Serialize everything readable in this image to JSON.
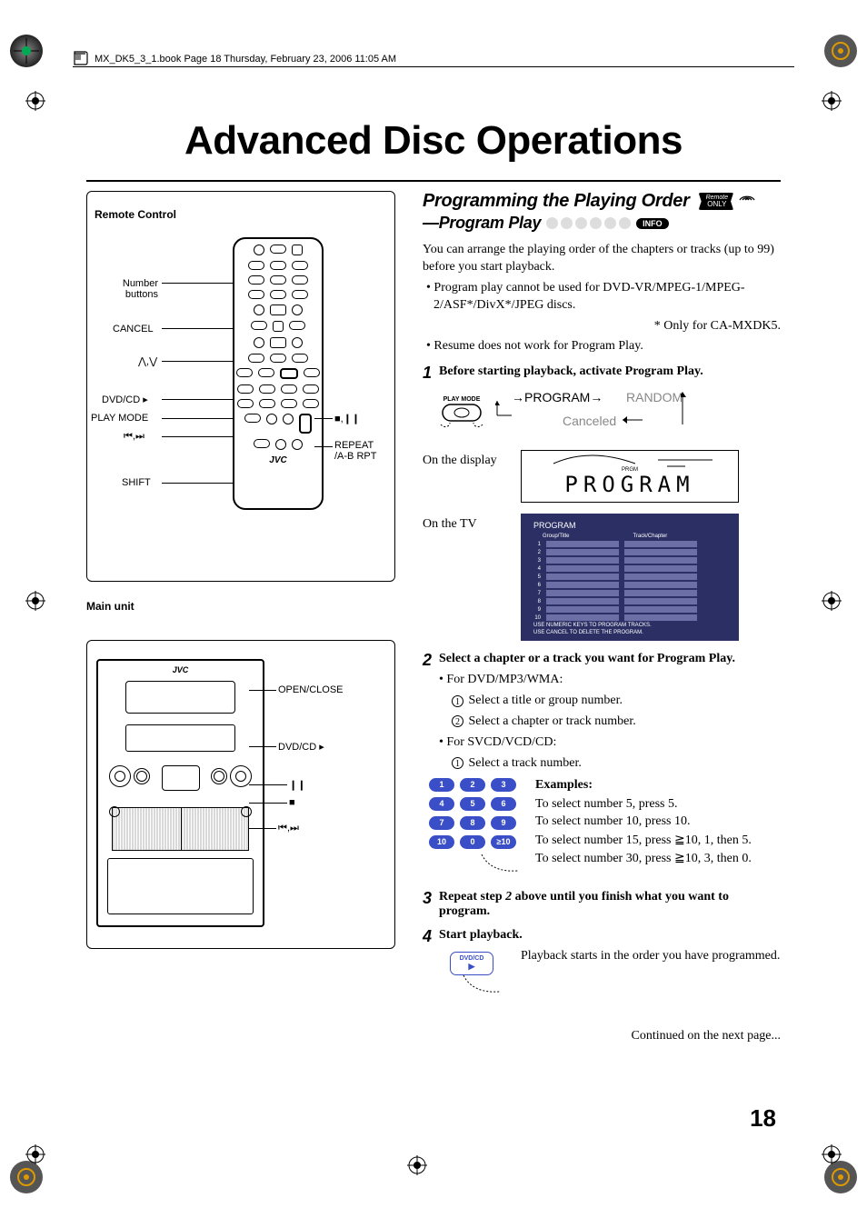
{
  "header": {
    "meta": "MX_DK5_3_1.book  Page 18  Thursday, February 23, 2006  11:05 AM"
  },
  "title": "Advanced Disc Operations",
  "left": {
    "remote_title": "Remote Control",
    "main_title": "Main unit",
    "remote_labels": {
      "number_buttons": "Number\nbuttons",
      "cancel": "CANCEL",
      "cursors": "⋀,⋁",
      "dvdcd": "DVD/CD ▸",
      "playmode": "PLAY MODE",
      "prevnext": "⏮,⏭",
      "shift": "SHIFT",
      "stop_pause": "■,❙❙",
      "repeat": "REPEAT\n/A-B RPT",
      "brand": "JVC"
    },
    "main_labels": {
      "open_close": "OPEN/CLOSE",
      "dvdcd": "DVD/CD ▸",
      "pause": "❙❙",
      "stop": "■",
      "prevnext": "⏮,⏭",
      "brand": "JVC"
    }
  },
  "right": {
    "heading": "Programming the Playing Order",
    "remote_only_1": "Remote",
    "remote_only_2": "ONLY",
    "subheading": "—Program Play",
    "info": "INFO",
    "intro1": "You can arrange the playing order of the chapters or tracks (up to 99) before you start playback.",
    "intro2": "Program play cannot be used for DVD-VR/MPEG-1/MPEG-2/ASF*/DivX*/JPEG discs.",
    "intro2_note": "* Only for CA-MXDK5.",
    "intro3": "Resume does not work for Program Play.",
    "step1": "Before starting playback, activate Program Play.",
    "pm": {
      "btn": "PLAY MODE",
      "program": "PROGRAM",
      "random": "RANDOM",
      "canceled": "Canceled"
    },
    "display_label": "On the display",
    "lcd_text": "PROGRAM",
    "tv_label": "On the TV",
    "tv": {
      "title": "PROGRAM",
      "col1": "Group/Title",
      "col2": "Track/Chapter",
      "footer1": "USE NUMERIC KEYS TO PROGRAM TRACKS.",
      "footer2": "USE CANCEL TO DELETE THE PROGRAM."
    },
    "step2": "Select a chapter or a track you want for Program Play.",
    "s2_a": "For DVD/MP3/WMA:",
    "s2_a1": "Select a title or group number.",
    "s2_a2": "Select a chapter or track number.",
    "s2_b": "For SVCD/VCD/CD:",
    "s2_b1": "Select a track number.",
    "examples_h": "Examples:",
    "ex1": "To select number 5, press 5.",
    "ex2": "To select number 10, press 10.",
    "ex3a": "To select number 15, press ",
    "ex3b": "10, 1, then 5.",
    "ex4a": "To select number 30, press ",
    "ex4b": "10, 3, then 0.",
    "keypad": [
      [
        "1",
        "2",
        "3"
      ],
      [
        "4",
        "5",
        "6"
      ],
      [
        "7",
        "8",
        "9"
      ],
      [
        "10",
        "0",
        "≥10"
      ]
    ],
    "step3a": "Repeat step ",
    "step3b": "2",
    "step3c": " above until you finish what you want to program.",
    "step4": "Start playback.",
    "dvdcd_lbl": "DVD/CD",
    "playback_text": "Playback starts in the order you have programmed.",
    "continued": "Continued on the next page...",
    "page_number": "18"
  }
}
